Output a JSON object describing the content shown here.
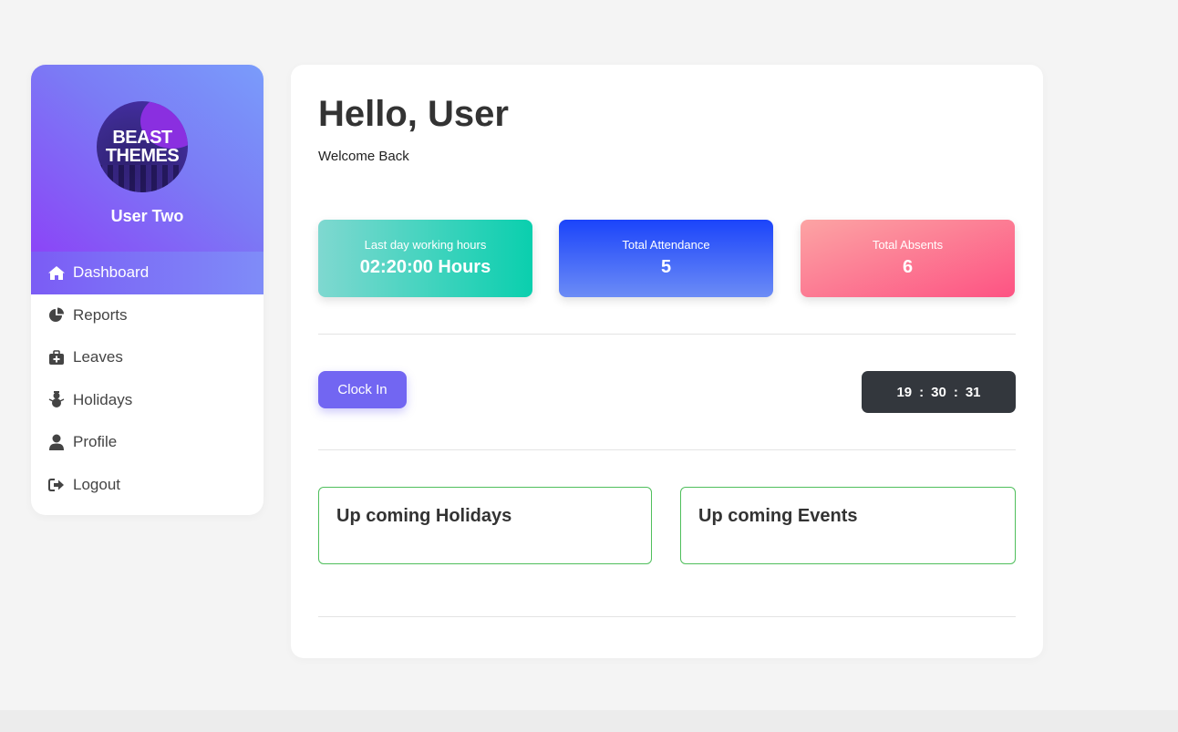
{
  "sidebar": {
    "logo_text_line1": "BEAST",
    "logo_text_line2": "THEMES",
    "user_name": "User Two",
    "items": [
      {
        "label": "Dashboard",
        "icon": "home-icon",
        "active": true
      },
      {
        "label": "Reports",
        "icon": "pie-chart-icon",
        "active": false
      },
      {
        "label": "Leaves",
        "icon": "medical-kit-icon",
        "active": false
      },
      {
        "label": "Holidays",
        "icon": "snowman-icon",
        "active": false
      },
      {
        "label": "Profile",
        "icon": "user-icon",
        "active": false
      },
      {
        "label": "Logout",
        "icon": "logout-icon",
        "active": false
      }
    ]
  },
  "main": {
    "greeting": "Hello, User",
    "welcome": "Welcome Back",
    "stats": {
      "hours": {
        "label": "Last day working hours",
        "value": "02:20:00 Hours"
      },
      "attendance": {
        "label": "Total Attendance",
        "value": "5"
      },
      "absents": {
        "label": "Total Absents",
        "value": "6"
      }
    },
    "clock_in_label": "Clock In",
    "timer": {
      "hours": "19",
      "minutes": "30",
      "seconds": "31",
      "separator": ":"
    },
    "panels": {
      "holidays_title": "Up coming Holidays",
      "events_title": "Up coming Events"
    }
  },
  "colors": {
    "accent": "#7266f2",
    "panel_border": "#4fbf5c",
    "timer_bg": "#33373d"
  }
}
